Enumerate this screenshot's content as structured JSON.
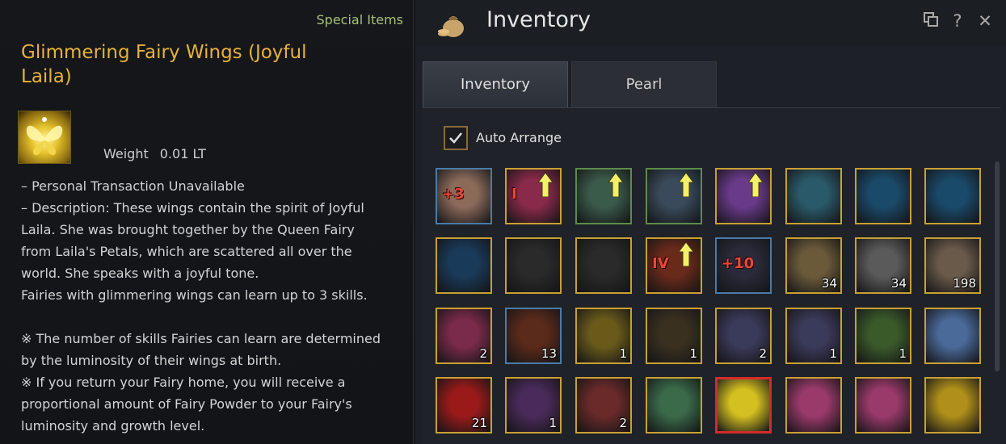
{
  "tooltip": {
    "category": "Special Items",
    "title": "Glimmering Fairy Wings (Joyful Laila)",
    "weight_label": "Weight",
    "weight_value": "0.01 LT",
    "lines": [
      "– Personal Transaction Unavailable",
      "– Description: These wings contain the spirit of Joyful",
      "Laila. She was brought together by the Queen Fairy",
      "from Laila's Petals, which are scattered all over the",
      "world. She speaks with a joyful tone.",
      "Fairies with glimmering wings can learn up to 3 skills.",
      "",
      "※ The number of skills Fairies can learn are determined",
      "by the luminosity of their wings at birth.",
      "※ If you return your Fairy home, you will receive a",
      "proportional amount of Fairy Powder to your Fairy's",
      "luminosity and growth level."
    ]
  },
  "inventory": {
    "title": "Inventory",
    "tabs": [
      "Inventory",
      "Pearl"
    ],
    "auto_arrange_label": "Auto Arrange",
    "auto_arrange_checked": true,
    "header_icons": [
      "window-mode-icon",
      "help-icon",
      "close-icon"
    ],
    "slots": [
      {
        "name": "armor-plus3",
        "enh": "+3",
        "count": "",
        "border": "blue",
        "color": "#8b6a5a",
        "upgrade": false
      },
      {
        "name": "earring-i",
        "enh": "I",
        "count": "",
        "border": "yellow",
        "color": "#8a2a4a",
        "upgrade": true
      },
      {
        "name": "necklace-green",
        "enh": "",
        "count": "",
        "border": "green",
        "color": "#3a5a4a",
        "upgrade": true
      },
      {
        "name": "necklace-green-2",
        "enh": "",
        "count": "",
        "border": "green",
        "color": "#3a4a5a",
        "upgrade": true
      },
      {
        "name": "belt-purple",
        "enh": "",
        "count": "",
        "border": "yellow",
        "color": "#6a3a8a",
        "upgrade": true
      },
      {
        "name": "pickaxe",
        "enh": "",
        "count": "",
        "border": "yellow",
        "color": "#2a5a6a",
        "upgrade": false
      },
      {
        "name": "shovel-blue",
        "enh": "",
        "count": "",
        "border": "yellow",
        "color": "#1a4a6a",
        "upgrade": false
      },
      {
        "name": "shovel-blue-2",
        "enh": "",
        "count": "",
        "border": "yellow",
        "color": "#1a4a6a",
        "upgrade": false
      },
      {
        "name": "cleaver-blue",
        "enh": "",
        "count": "",
        "border": "yellow",
        "color": "#1a3a5a",
        "upgrade": false
      },
      {
        "name": "cleaver-dark",
        "enh": "",
        "count": "",
        "border": "yellow",
        "color": "#2a2a2a",
        "upgrade": false
      },
      {
        "name": "sickle",
        "enh": "",
        "count": "",
        "border": "yellow",
        "color": "#2a2a2a",
        "upgrade": false
      },
      {
        "name": "weapon-iv",
        "enh": "IV",
        "count": "",
        "border": "yellow",
        "color": "#6a2a1a",
        "upgrade": true
      },
      {
        "name": "staff-plus10",
        "enh": "+10",
        "count": "",
        "border": "blue",
        "color": "#2a2a3a",
        "upgrade": false
      },
      {
        "name": "food-platter",
        "enh": "",
        "count": "34",
        "border": "yellow",
        "color": "#6a5a3a",
        "upgrade": false
      },
      {
        "name": "food-platter-2",
        "enh": "",
        "count": "34",
        "border": "yellow",
        "color": "#5a5a5a",
        "upgrade": false
      },
      {
        "name": "food-platter-3",
        "enh": "",
        "count": "198",
        "border": "yellow",
        "color": "#6a5a4a",
        "upgrade": false
      },
      {
        "name": "potion-pink",
        "enh": "",
        "count": "2",
        "border": "yellow",
        "color": "#7a2a4a",
        "upgrade": false
      },
      {
        "name": "chocolate",
        "enh": "",
        "count": "13",
        "border": "blue",
        "color": "#5a2a1a",
        "upgrade": false
      },
      {
        "name": "golden-elixir",
        "enh": "",
        "count": "1",
        "border": "yellow",
        "color": "#6a5a1a",
        "upgrade": false
      },
      {
        "name": "small-vial",
        "enh": "",
        "count": "1",
        "border": "yellow",
        "color": "#3a3020",
        "upgrade": false
      },
      {
        "name": "scroll-blue",
        "enh": "",
        "count": "2",
        "border": "yellow",
        "color": "#3a3a5a",
        "upgrade": false
      },
      {
        "name": "scroll-blue-2",
        "enh": "",
        "count": "1",
        "border": "yellow",
        "color": "#3a3a5a",
        "upgrade": false
      },
      {
        "name": "chest-green",
        "enh": "",
        "count": "1",
        "border": "yellow",
        "color": "#3a5a2a",
        "upgrade": false
      },
      {
        "name": "gift-box-blue",
        "enh": "",
        "count": "",
        "border": "yellow",
        "color": "#4a6a9a",
        "upgrade": false
      },
      {
        "name": "heart-box",
        "enh": "",
        "count": "21",
        "border": "yellow",
        "color": "#9a1a1a",
        "upgrade": false
      },
      {
        "name": "chest-purple",
        "enh": "",
        "count": "1",
        "border": "yellow",
        "color": "#4a2a5a",
        "upgrade": false
      },
      {
        "name": "chest-red",
        "enh": "",
        "count": "2",
        "border": "yellow",
        "color": "#6a2a2a",
        "upgrade": false
      },
      {
        "name": "gift-box-green",
        "enh": "",
        "count": "",
        "border": "yellow",
        "color": "#3a6a4a",
        "upgrade": false
      },
      {
        "name": "fairy-wings-selected",
        "enh": "",
        "count": "",
        "border": "red",
        "color": "#d4c020",
        "upgrade": false
      },
      {
        "name": "fairy-wings-pink",
        "enh": "",
        "count": "",
        "border": "yellow",
        "color": "#9a3a6a",
        "upgrade": false
      },
      {
        "name": "fairy-wings-pink-2",
        "enh": "",
        "count": "",
        "border": "yellow",
        "color": "#9a3a6a",
        "upgrade": false
      },
      {
        "name": "fairy-wings-gold",
        "enh": "",
        "count": "",
        "border": "yellow",
        "color": "#b0901a",
        "upgrade": false
      }
    ]
  }
}
